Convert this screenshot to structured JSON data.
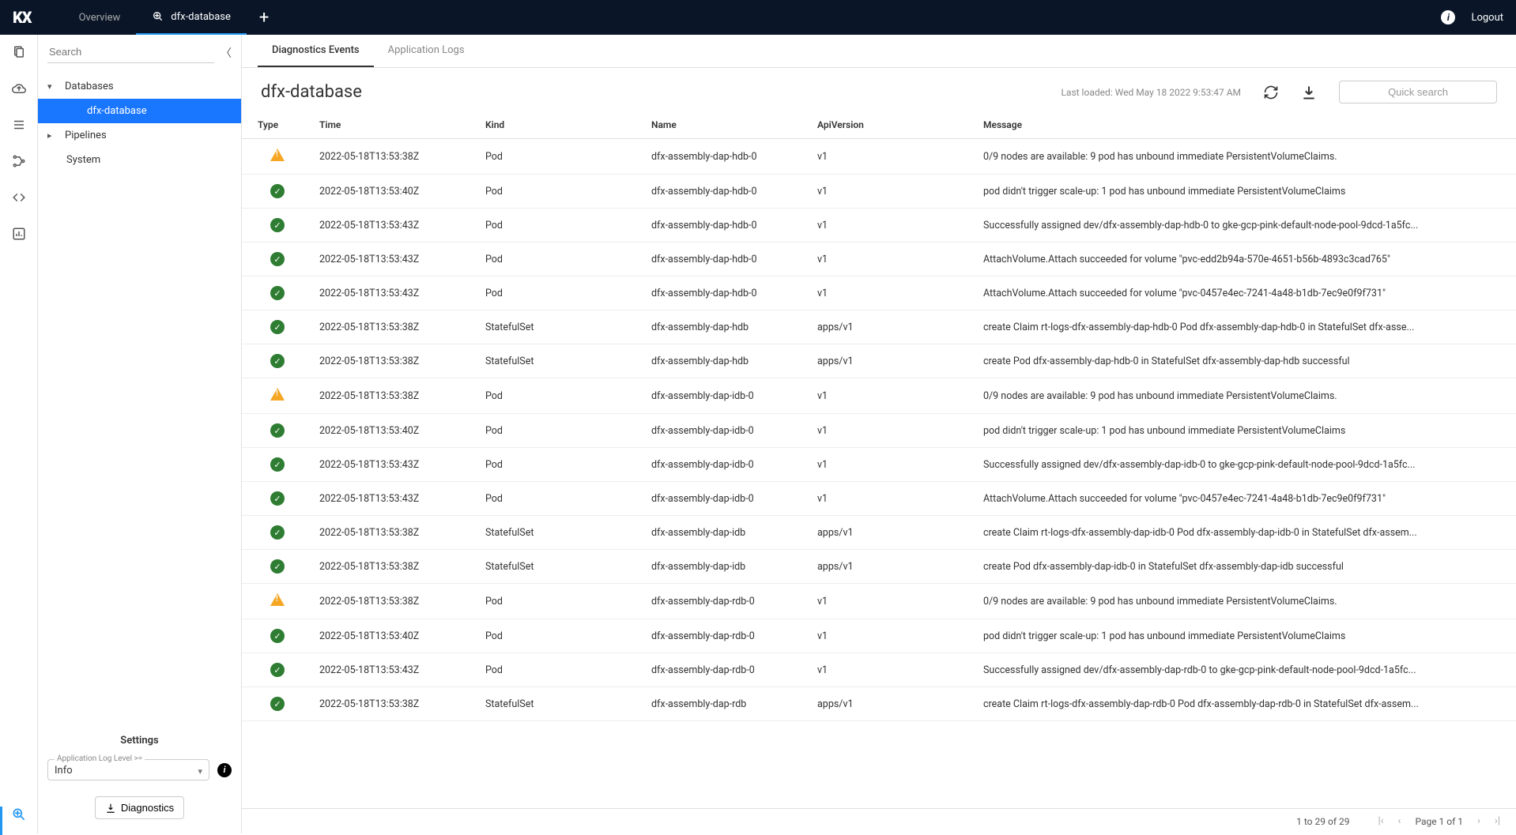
{
  "topbar": {
    "logo": "KX",
    "tabs": [
      {
        "label": "Overview",
        "active": false
      },
      {
        "label": "dfx-database",
        "active": true
      }
    ],
    "logout_label": "Logout"
  },
  "sidebar": {
    "search_placeholder": "Search",
    "tree": {
      "databases_label": "Databases",
      "dfx_database_label": "dfx-database",
      "pipelines_label": "Pipelines",
      "system_label": "System"
    },
    "settings": {
      "title": "Settings",
      "log_level_label": "Application Log Level >=",
      "log_level_value": "Info",
      "diagnostics_btn": "Diagnostics"
    }
  },
  "main": {
    "subtabs": {
      "diagnostics": "Diagnostics Events",
      "applogs": "Application Logs"
    },
    "title": "dfx-database",
    "last_loaded": "Last loaded: Wed May 18 2022 9:53:47 AM",
    "quick_search_placeholder": "Quick search",
    "columns": {
      "type": "Type",
      "time": "Time",
      "kind": "Kind",
      "name": "Name",
      "api": "ApiVersion",
      "msg": "Message"
    },
    "rows": [
      {
        "type": "warn",
        "time": "2022-05-18T13:53:38Z",
        "kind": "Pod",
        "name": "dfx-assembly-dap-hdb-0",
        "api": "v1",
        "msg": "0/9 nodes are available: 9 pod has unbound immediate PersistentVolumeClaims."
      },
      {
        "type": "ok",
        "time": "2022-05-18T13:53:40Z",
        "kind": "Pod",
        "name": "dfx-assembly-dap-hdb-0",
        "api": "v1",
        "msg": "pod didn't trigger scale-up: 1 pod has unbound immediate PersistentVolumeClaims"
      },
      {
        "type": "ok",
        "time": "2022-05-18T13:53:43Z",
        "kind": "Pod",
        "name": "dfx-assembly-dap-hdb-0",
        "api": "v1",
        "msg": "Successfully assigned dev/dfx-assembly-dap-hdb-0 to gke-gcp-pink-default-node-pool-9dcd-1a5fc..."
      },
      {
        "type": "ok",
        "time": "2022-05-18T13:53:43Z",
        "kind": "Pod",
        "name": "dfx-assembly-dap-hdb-0",
        "api": "v1",
        "msg": "AttachVolume.Attach succeeded for volume \"pvc-edd2b94a-570e-4651-b56b-4893c3cad765\""
      },
      {
        "type": "ok",
        "time": "2022-05-18T13:53:43Z",
        "kind": "Pod",
        "name": "dfx-assembly-dap-hdb-0",
        "api": "v1",
        "msg": "AttachVolume.Attach succeeded for volume \"pvc-0457e4ec-7241-4a48-b1db-7ec9e0f9f731\""
      },
      {
        "type": "ok",
        "time": "2022-05-18T13:53:38Z",
        "kind": "StatefulSet",
        "name": "dfx-assembly-dap-hdb",
        "api": "apps/v1",
        "msg": "create Claim rt-logs-dfx-assembly-dap-hdb-0 Pod dfx-assembly-dap-hdb-0 in StatefulSet dfx-asse..."
      },
      {
        "type": "ok",
        "time": "2022-05-18T13:53:38Z",
        "kind": "StatefulSet",
        "name": "dfx-assembly-dap-hdb",
        "api": "apps/v1",
        "msg": "create Pod dfx-assembly-dap-hdb-0 in StatefulSet dfx-assembly-dap-hdb successful"
      },
      {
        "type": "warn",
        "time": "2022-05-18T13:53:38Z",
        "kind": "Pod",
        "name": "dfx-assembly-dap-idb-0",
        "api": "v1",
        "msg": "0/9 nodes are available: 9 pod has unbound immediate PersistentVolumeClaims."
      },
      {
        "type": "ok",
        "time": "2022-05-18T13:53:40Z",
        "kind": "Pod",
        "name": "dfx-assembly-dap-idb-0",
        "api": "v1",
        "msg": "pod didn't trigger scale-up: 1 pod has unbound immediate PersistentVolumeClaims"
      },
      {
        "type": "ok",
        "time": "2022-05-18T13:53:43Z",
        "kind": "Pod",
        "name": "dfx-assembly-dap-idb-0",
        "api": "v1",
        "msg": "Successfully assigned dev/dfx-assembly-dap-idb-0 to gke-gcp-pink-default-node-pool-9dcd-1a5fc..."
      },
      {
        "type": "ok",
        "time": "2022-05-18T13:53:43Z",
        "kind": "Pod",
        "name": "dfx-assembly-dap-idb-0",
        "api": "v1",
        "msg": "AttachVolume.Attach succeeded for volume \"pvc-0457e4ec-7241-4a48-b1db-7ec9e0f9f731\""
      },
      {
        "type": "ok",
        "time": "2022-05-18T13:53:38Z",
        "kind": "StatefulSet",
        "name": "dfx-assembly-dap-idb",
        "api": "apps/v1",
        "msg": "create Claim rt-logs-dfx-assembly-dap-idb-0 Pod dfx-assembly-dap-idb-0 in StatefulSet dfx-assem..."
      },
      {
        "type": "ok",
        "time": "2022-05-18T13:53:38Z",
        "kind": "StatefulSet",
        "name": "dfx-assembly-dap-idb",
        "api": "apps/v1",
        "msg": "create Pod dfx-assembly-dap-idb-0 in StatefulSet dfx-assembly-dap-idb successful"
      },
      {
        "type": "warn",
        "time": "2022-05-18T13:53:38Z",
        "kind": "Pod",
        "name": "dfx-assembly-dap-rdb-0",
        "api": "v1",
        "msg": "0/9 nodes are available: 9 pod has unbound immediate PersistentVolumeClaims."
      },
      {
        "type": "ok",
        "time": "2022-05-18T13:53:40Z",
        "kind": "Pod",
        "name": "dfx-assembly-dap-rdb-0",
        "api": "v1",
        "msg": "pod didn't trigger scale-up: 1 pod has unbound immediate PersistentVolumeClaims"
      },
      {
        "type": "ok",
        "time": "2022-05-18T13:53:43Z",
        "kind": "Pod",
        "name": "dfx-assembly-dap-rdb-0",
        "api": "v1",
        "msg": "Successfully assigned dev/dfx-assembly-dap-rdb-0 to gke-gcp-pink-default-node-pool-9dcd-1a5fc..."
      },
      {
        "type": "ok",
        "time": "2022-05-18T13:53:38Z",
        "kind": "StatefulSet",
        "name": "dfx-assembly-dap-rdb",
        "api": "apps/v1",
        "msg": "create Claim rt-logs-dfx-assembly-dap-rdb-0 Pod dfx-assembly-dap-rdb-0 in StatefulSet dfx-assem..."
      }
    ],
    "footer": {
      "range": "1 to 29 of 29",
      "page": "Page 1 of 1"
    }
  }
}
